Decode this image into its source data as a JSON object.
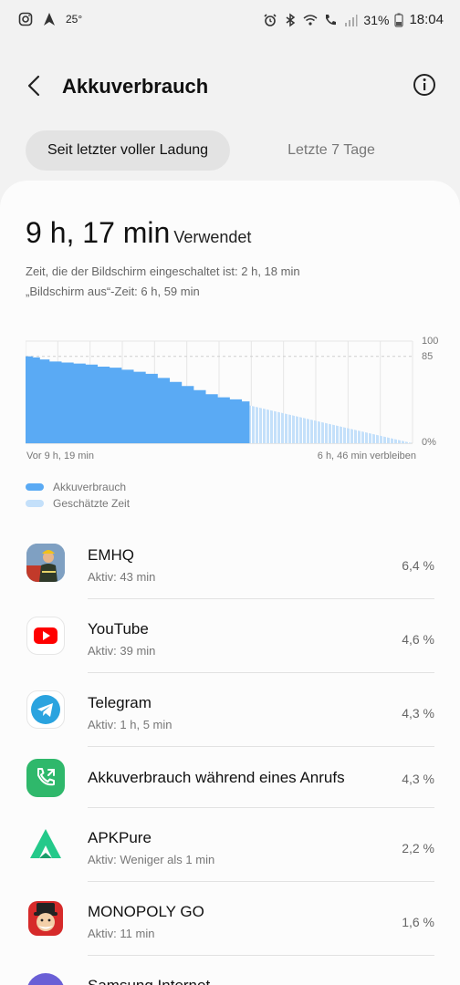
{
  "status_bar": {
    "temperature": "25°",
    "battery_percent": "31%",
    "time": "18:04",
    "icons_left": [
      "instagram-icon",
      "navigation-arrow-icon"
    ],
    "icons_right": [
      "alarm-icon",
      "bluetooth-icon",
      "wifi-call-icon",
      "volte-call-icon",
      "signal-icon",
      "battery-icon"
    ]
  },
  "header": {
    "title": "Akkuverbrauch",
    "back_icon": "back-arrow-icon",
    "info_icon": "info-icon"
  },
  "tabs": [
    {
      "label": "Seit letzter voller Ladung",
      "active": true
    },
    {
      "label": "Letzte 7 Tage",
      "active": false
    }
  ],
  "usage": {
    "total": "9 h, 17 min",
    "total_label": "Verwendet",
    "screen_on": "Zeit, die der Bildschirm eingeschaltet ist: 2 h, 18 min",
    "screen_off": "„Bildschirm aus“-Zeit: 6 h, 59 min"
  },
  "chart_data": {
    "type": "area",
    "series": [
      {
        "name": "Akkuverbrauch",
        "x_hours": [
          0,
          0.3,
          0.6,
          1.0,
          1.5,
          2.0,
          2.5,
          3.0,
          3.5,
          4.0,
          4.5,
          5.0,
          5.5,
          6.0,
          6.5,
          7.0,
          7.5,
          8.0,
          8.5,
          9.0,
          9.32
        ],
        "values": [
          85,
          84,
          82,
          80,
          79,
          78,
          77,
          75,
          74,
          72,
          70,
          68,
          64,
          60,
          56,
          52,
          48,
          45,
          43,
          41,
          37
        ]
      },
      {
        "name": "Geschätzte Zeit",
        "x_hours": [
          9.32,
          16.1
        ],
        "values": [
          37,
          0
        ]
      }
    ],
    "x_start_label": "Vor 9 h, 19 min",
    "x_end_label": "6 h, 46 min verbleiben",
    "y_ticks": [
      "100",
      "85",
      "0%"
    ],
    "ylim": [
      0,
      100
    ],
    "xlim": [
      0,
      16.1
    ],
    "grid": true,
    "colors": {
      "actual": "#5aaaf4",
      "estimate": "#c4e0fa"
    }
  },
  "legend": [
    {
      "label": "Akkuverbrauch",
      "color": "#5aaaf4"
    },
    {
      "label": "Geschätzte Zeit",
      "color": "#c4e0fa"
    }
  ],
  "apps": [
    {
      "name": "EMHQ",
      "sub": "Aktiv: 43 min",
      "percent": "6,4 %",
      "icon": "emhq-firefighter-icon",
      "color": "#7a9bb8"
    },
    {
      "name": "YouTube",
      "sub": "Aktiv: 39 min",
      "percent": "4,6 %",
      "icon": "youtube-icon",
      "color": "#ff0000"
    },
    {
      "name": "Telegram",
      "sub": "Aktiv: 1 h, 5 min",
      "percent": "4,3 %",
      "icon": "telegram-icon",
      "color": "#2aa3df"
    },
    {
      "name": "Akkuverbrauch während eines Anrufs",
      "sub": "",
      "percent": "4,3 %",
      "icon": "phone-call-icon",
      "color": "#2fb86b"
    },
    {
      "name": "APKPure",
      "sub": "Aktiv: Weniger als 1 min",
      "percent": "2,2 %",
      "icon": "apkpure-icon",
      "color": "#24c98a"
    },
    {
      "name": "MONOPOLY GO",
      "sub": "Aktiv: 11 min",
      "percent": "1,6 %",
      "icon": "monopoly-go-icon",
      "color": "#d62a2a"
    },
    {
      "name": "Samsung Internet",
      "sub": "",
      "percent": "",
      "icon": "samsung-internet-icon",
      "color": "#6a5fd6"
    }
  ]
}
